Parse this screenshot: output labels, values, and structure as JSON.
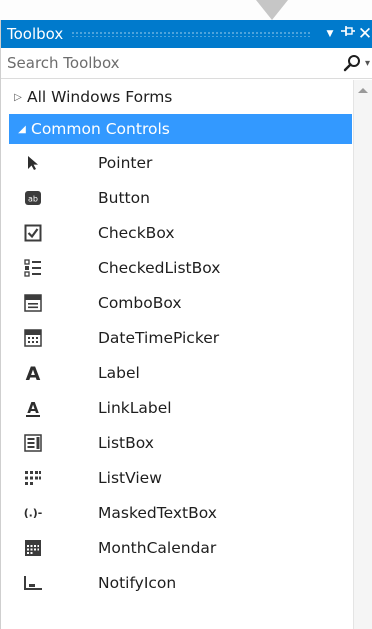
{
  "window": {
    "title": "Toolbox",
    "buttons": {
      "dropdown": "▼",
      "pin": "⊣",
      "close": "✕"
    }
  },
  "search": {
    "placeholder": "Search Toolbox"
  },
  "groups": [
    {
      "label": "All Windows Forms",
      "expanded": false
    },
    {
      "label": "Common Controls",
      "expanded": true,
      "selected": true
    }
  ],
  "items": [
    {
      "label": "Pointer",
      "icon": "pointer-icon"
    },
    {
      "label": "Button",
      "icon": "button-icon"
    },
    {
      "label": "CheckBox",
      "icon": "checkbox-icon"
    },
    {
      "label": "CheckedListBox",
      "icon": "checked-list-box-icon"
    },
    {
      "label": "ComboBox",
      "icon": "combo-box-icon"
    },
    {
      "label": "DateTimePicker",
      "icon": "date-time-picker-icon"
    },
    {
      "label": "Label",
      "icon": "label-icon"
    },
    {
      "label": "LinkLabel",
      "icon": "link-label-icon"
    },
    {
      "label": "ListBox",
      "icon": "list-box-icon"
    },
    {
      "label": "ListView",
      "icon": "list-view-icon"
    },
    {
      "label": "MaskedTextBox",
      "icon": "masked-text-box-icon"
    },
    {
      "label": "MonthCalendar",
      "icon": "month-calendar-icon"
    },
    {
      "label": "NotifyIcon",
      "icon": "notify-icon-icon"
    }
  ],
  "colors": {
    "accent": "#007acc",
    "selection": "#3399ff"
  }
}
